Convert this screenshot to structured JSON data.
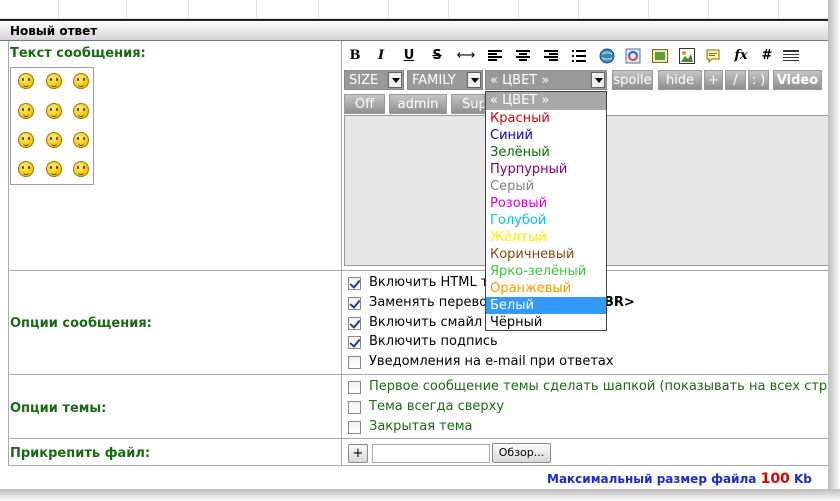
{
  "header": {
    "title": "Новый ответ"
  },
  "labels": {
    "message_text": "Текст сообщения:",
    "message_options": "Опции сообщения:",
    "topic_options": "Опции темы:",
    "attach_file": "Прикрепить файл:"
  },
  "toolbar": {
    "bold": "B",
    "italic": "I",
    "underline": "U",
    "strike": "S",
    "fx": "fx",
    "hash": "#"
  },
  "bbcode": {
    "size": "SIZE",
    "family": "FAMILY",
    "color": "« ЦВЕТ »",
    "spoiler": "spoile",
    "hide": "hide",
    "plus": "+",
    "slash": "/",
    "colon": ": )",
    "video": "Video",
    "off": "Off",
    "admin": "admin",
    "sup": "Sup"
  },
  "color_dropdown": {
    "header": "« ЦВЕТ »",
    "selected": "Белый",
    "options": [
      {
        "label": "Красный",
        "color": "#e00000"
      },
      {
        "label": "Синий",
        "color": "#0000cc"
      },
      {
        "label": "Зелёный",
        "color": "#007000"
      },
      {
        "label": "Пурпурный",
        "color": "#800080"
      },
      {
        "label": "Серый",
        "color": "#808080"
      },
      {
        "label": "Розовый",
        "color": "#e000e0"
      },
      {
        "label": "Голубой",
        "color": "#00c8e0"
      },
      {
        "label": "Жёлтый",
        "color": "#ffee00"
      },
      {
        "label": "Коричневый",
        "color": "#8b4513"
      },
      {
        "label": "Ярко-зелёный",
        "color": "#33cc33"
      },
      {
        "label": "Оранжевый",
        "color": "#ff9900"
      },
      {
        "label": "Белый",
        "color": "#ffffff"
      },
      {
        "label": "Чёрный",
        "color": "#000000"
      }
    ]
  },
  "message_options": [
    {
      "label": "Включить HTML т",
      "checked": true
    },
    {
      "label": "Заменять перево",
      "checked": true
    },
    {
      "label": "Включить смайл",
      "checked": true
    },
    {
      "label": "Включить подпись",
      "checked": true
    },
    {
      "label": "Уведомления на e-mail при ответах",
      "checked": false
    }
  ],
  "br_suffix": "BR>",
  "topic_options": [
    {
      "label": "Первое сообщение темы сделать шапкой (показывать на всех стра",
      "checked": false
    },
    {
      "label": "Тема всегда сверху",
      "checked": false
    },
    {
      "label": "Закрытая тема",
      "checked": false
    }
  ],
  "attach": {
    "add_button": "+",
    "browse_button": "Обзор..."
  },
  "footer": {
    "max_size_label": "Максимальный размер файла",
    "max_size_value": "100",
    "max_size_unit": "Kb"
  }
}
